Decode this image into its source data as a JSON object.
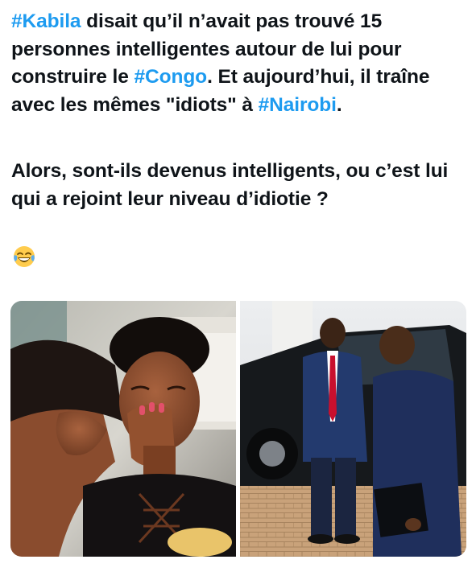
{
  "post": {
    "paragraph1": [
      {
        "text": "#Kabila",
        "hashtag": true
      },
      {
        "text": " disait qu’il n’avait pas trouvé 15 personnes intelligentes autour de lui pour construire le ",
        "hashtag": false
      },
      {
        "text": "#Congo",
        "hashtag": true
      },
      {
        "text": ". Et aujourd’hui, il traîne avec les mêmes \"idiots\" à ",
        "hashtag": false
      },
      {
        "text": "#Nairobi",
        "hashtag": true
      },
      {
        "text": ".",
        "hashtag": false
      }
    ],
    "paragraph2": "Alors, sont-ils devenus intelligents, ou c’est lui qui a rejoint leur niveau d’idiotie ?",
    "emoji": "laughing-tears-emoji"
  },
  "media": {
    "left_photo": "photo-women-laughing",
    "right_photo": "photo-men-beside-suv"
  },
  "colors": {
    "text": "#0f1419",
    "hashtag": "#1d9bf0",
    "background": "#ffffff"
  }
}
